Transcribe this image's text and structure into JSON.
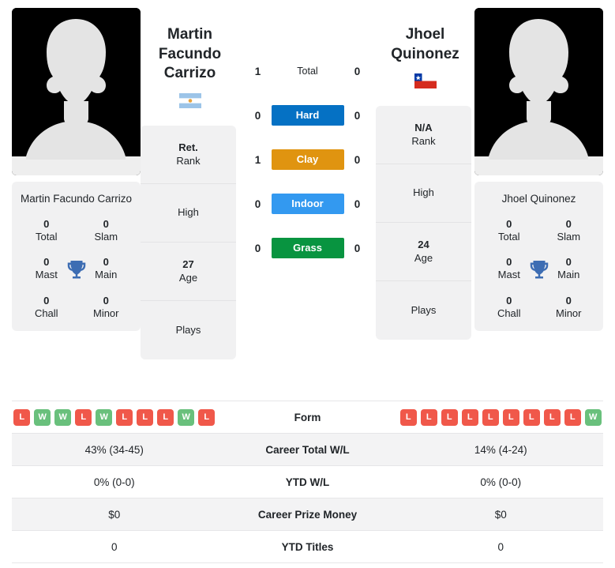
{
  "colors": {
    "hard": "#0571c4",
    "clay": "#e09410",
    "indoor": "#3399f0",
    "grass": "#089440",
    "win": "#69c07c",
    "loss": "#f0584a",
    "card_bg": "#f1f1f2",
    "row_alt": "#f3f3f4"
  },
  "players": {
    "left": {
      "name": "Martin Facundo Carrizo",
      "name_line1": "Martin Facundo",
      "name_line2": "Carrizo",
      "flag": "argentina-flag",
      "photo": "player-photo-placeholder",
      "titles": {
        "card_name": "Martin Facundo Carrizo",
        "cells": [
          {
            "value": "0",
            "label": "Total"
          },
          {
            "value": "0",
            "label": "Slam"
          },
          {
            "value": "0",
            "label": "Mast"
          },
          {
            "value": "0",
            "label": "Main"
          },
          {
            "value": "0",
            "label": "Chall"
          },
          {
            "value": "0",
            "label": "Minor"
          }
        ],
        "icon": "trophy-icon"
      },
      "info": [
        {
          "value": "Ret.",
          "label": "Rank"
        },
        {
          "value": "",
          "label": "High"
        },
        {
          "value": "27",
          "label": "Age"
        },
        {
          "value": "",
          "label": "Plays"
        }
      ],
      "form": [
        "L",
        "W",
        "W",
        "L",
        "W",
        "L",
        "L",
        "L",
        "W",
        "L"
      ]
    },
    "right": {
      "name": "Jhoel Quinonez",
      "name_line1": "Jhoel",
      "name_line2": "Quinonez",
      "flag": "chile-flag",
      "photo": "player-photo-placeholder",
      "titles": {
        "card_name": "Jhoel Quinonez",
        "cells": [
          {
            "value": "0",
            "label": "Total"
          },
          {
            "value": "0",
            "label": "Slam"
          },
          {
            "value": "0",
            "label": "Mast"
          },
          {
            "value": "0",
            "label": "Main"
          },
          {
            "value": "0",
            "label": "Chall"
          },
          {
            "value": "0",
            "label": "Minor"
          }
        ],
        "icon": "trophy-icon"
      },
      "info": [
        {
          "value": "N/A",
          "label": "Rank"
        },
        {
          "value": "",
          "label": "High"
        },
        {
          "value": "24",
          "label": "Age"
        },
        {
          "value": "",
          "label": "Plays"
        }
      ],
      "form": [
        "L",
        "L",
        "L",
        "L",
        "L",
        "L",
        "L",
        "L",
        "L",
        "W"
      ]
    }
  },
  "surfaces": [
    {
      "label": "Total",
      "left": "1",
      "right": "0",
      "style": "plain"
    },
    {
      "label": "Hard",
      "left": "0",
      "right": "0",
      "style": "hard"
    },
    {
      "label": "Clay",
      "left": "1",
      "right": "0",
      "style": "clay"
    },
    {
      "label": "Indoor",
      "left": "0",
      "right": "0",
      "style": "indoor"
    },
    {
      "label": "Grass",
      "left": "0",
      "right": "0",
      "style": "grass"
    }
  ],
  "comparison": [
    {
      "label": "Form",
      "left": "",
      "right": "",
      "type": "form",
      "alt": false
    },
    {
      "label": "Career Total W/L",
      "left": "43% (34-45)",
      "right": "14% (4-24)",
      "type": "text",
      "alt": true
    },
    {
      "label": "YTD W/L",
      "left": "0% (0-0)",
      "right": "0% (0-0)",
      "type": "text",
      "alt": false
    },
    {
      "label": "Career Prize Money",
      "left": "$0",
      "right": "$0",
      "type": "text",
      "alt": true
    },
    {
      "label": "YTD Titles",
      "left": "0",
      "right": "0",
      "type": "text",
      "alt": false
    }
  ]
}
